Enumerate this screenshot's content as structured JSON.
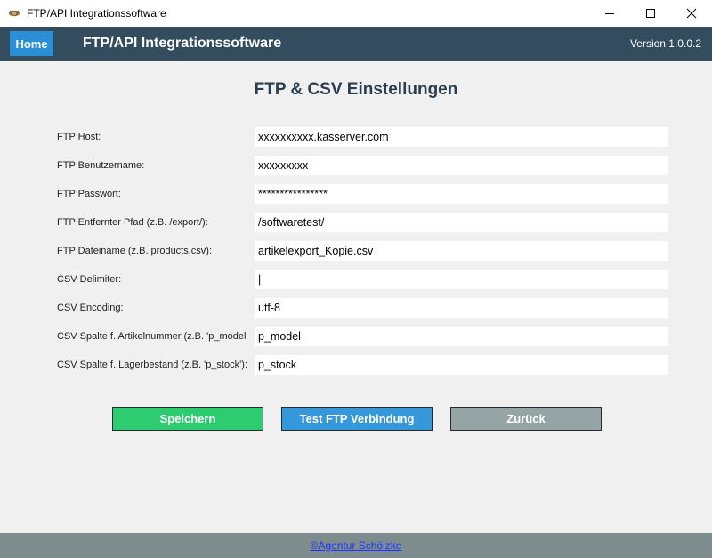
{
  "window": {
    "title": "FTP/API Integrationssoftware",
    "icon": "app-icon",
    "controls": [
      "minimize-icon",
      "maximize-icon",
      "close-icon"
    ]
  },
  "navbar": {
    "home_label": "Home",
    "title": "FTP/API Integrationssoftware",
    "version": "Version 1.0.0.2"
  },
  "page": {
    "title": "FTP & CSV Einstellungen"
  },
  "form": {
    "fields": [
      {
        "label": "FTP Host:",
        "value": "xxxxxxxxxx.kasserver.com"
      },
      {
        "label": "FTP Benutzername:",
        "value": "xxxxxxxxx"
      },
      {
        "label": "FTP Passwort:",
        "value": "****************"
      },
      {
        "label": "FTP Entfernter Pfad (z.B. /export/):",
        "value": "/softwaretest/"
      },
      {
        "label": "FTP Dateiname (z.B. products.csv):",
        "value": "artikelexport_Kopie.csv"
      },
      {
        "label": "CSV Delimiter:",
        "value": "|"
      },
      {
        "label": "CSV Encoding:",
        "value": "utf-8"
      },
      {
        "label": "CSV Spalte f. Artikelnummer (z.B. 'p_model'):",
        "value": "p_model"
      },
      {
        "label": "CSV Spalte f. Lagerbestand (z.B. 'p_stock'):",
        "value": "p_stock"
      }
    ]
  },
  "buttons": {
    "save": "Speichern",
    "test": "Test FTP Verbindung",
    "back": "Zurück"
  },
  "footer": {
    "link": "©Agentur Schölzke"
  },
  "colors": {
    "navbar": "#344d5e",
    "home": "#2b8fd8",
    "save": "#2ecc71",
    "test": "#3498db",
    "back": "#95a5a6",
    "footer": "#7f8c8d",
    "link": "#1a35ff"
  }
}
